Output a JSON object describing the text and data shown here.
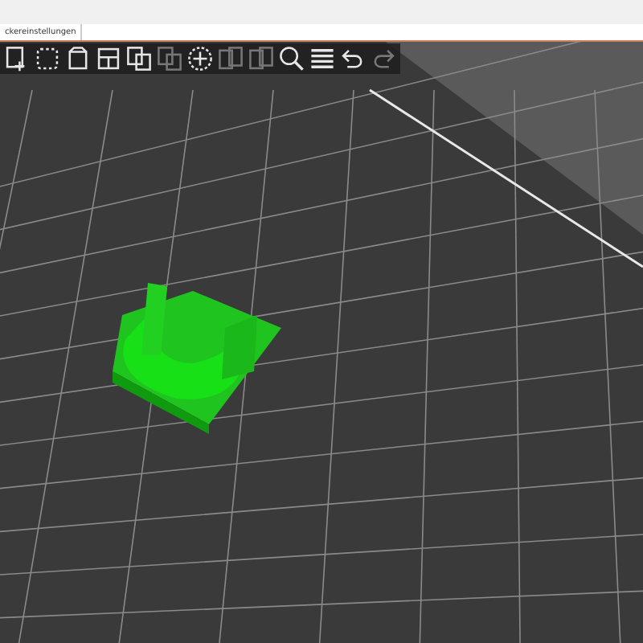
{
  "tab": {
    "label": "ckereinstellungen",
    "selected": true
  },
  "toolbar": [
    {
      "kind": "add",
      "disabled": false
    },
    {
      "kind": "delete",
      "disabled": false
    },
    {
      "kind": "delete-all",
      "disabled": false
    },
    {
      "kind": "arrange",
      "disabled": false
    },
    {
      "kind": "copy",
      "disabled": false
    },
    {
      "kind": "paste",
      "disabled": true
    },
    {
      "kind": "add-instance",
      "disabled": false
    },
    {
      "kind": "split",
      "disabled": true
    },
    {
      "kind": "split-parts",
      "disabled": true
    },
    {
      "kind": "search",
      "disabled": false
    },
    {
      "kind": "layers",
      "disabled": false
    },
    {
      "kind": "undo",
      "disabled": false
    },
    {
      "kind": "redo",
      "disabled": true
    }
  ]
}
